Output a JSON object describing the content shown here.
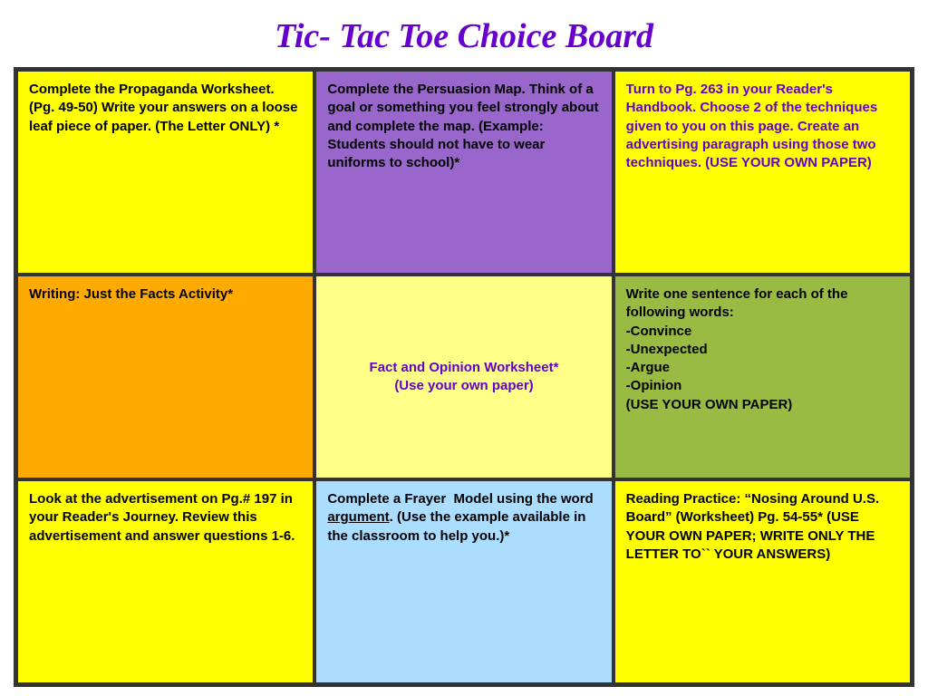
{
  "title": "Tic- Tac Toe Choice Board",
  "cells": [
    {
      "id": "r1c1",
      "text": " Complete the Propaganda Worksheet. (Pg. 49-50) Write your answers on a loose leaf piece of paper. (The Letter ONLY) *",
      "color_class": "cell-r1c1",
      "text_color": "text-black",
      "center": false
    },
    {
      "id": "r1c2",
      "text": "Complete the Persuasion Map. Think of a goal or something you feel strongly about and complete the map. (Example: Students should not have to wear uniforms to school)*",
      "color_class": "cell-r1c2",
      "text_color": "text-black",
      "center": false
    },
    {
      "id": "r1c3",
      "text": "Turn to Pg. 263 in your Reader's Handbook. Choose 2 of the techniques given to you on this page. Create an advertising paragraph using those two techniques. (USE YOUR OWN PAPER)",
      "color_class": "cell-r1c3",
      "text_color": "text-purple",
      "center": false
    },
    {
      "id": "r2c1",
      "text": "Writing: Just the Facts Activity*",
      "color_class": "cell-r2c1",
      "text_color": "text-black",
      "center": false
    },
    {
      "id": "r2c2",
      "text": "Fact and Opinion Worksheet*\n(Use your own paper)",
      "color_class": "cell-r2c2",
      "text_color": "text-purple",
      "center": true
    },
    {
      "id": "r2c3",
      "text": "Write one sentence for each of the following words:\n-Convince\n-Unexpected\n-Argue\n-Opinion\n(USE YOUR OWN PAPER)",
      "color_class": "cell-r2c3",
      "text_color": "text-black",
      "center": false
    },
    {
      "id": "r3c1",
      "text": "Look at the advertisement on Pg.# 197 in your Reader's Journey. Review this advertisement and answer questions 1-6.",
      "color_class": "cell-r3c1",
      "text_color": "text-black",
      "center": false
    },
    {
      "id": "r3c2",
      "text": "Complete a Frayer  Model using the word argument. (Use the example available in the classroom to help you.)*",
      "color_class": "cell-r3c2",
      "text_color": "text-black",
      "center": false,
      "underline_word": "argument"
    },
    {
      "id": "r3c3",
      "text": "Reading Practice: “Nosing Around U.S. Board” (Worksheet) Pg. 54-55* (USE YOUR OWN PAPER; WRITE ONLY THE LETTER TO`` YOUR ANSWERS)",
      "color_class": "cell-r3c3",
      "text_color": "text-black",
      "center": false
    }
  ]
}
